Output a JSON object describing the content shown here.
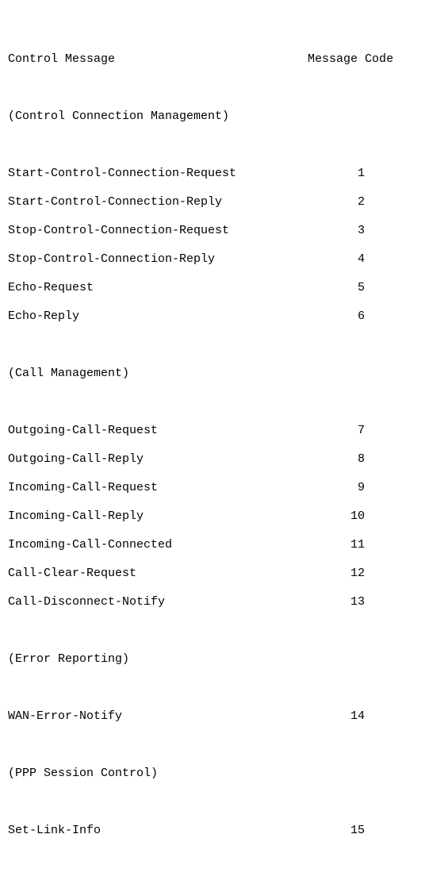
{
  "header": {
    "control_message": "Control Message",
    "message_code": "Message Code"
  },
  "groups": {
    "g1": {
      "title": "(Control Connection Management)",
      "rows": [
        {
          "name": "Start-Control-Connection-Request",
          "code": "1"
        },
        {
          "name": "Start-Control-Connection-Reply",
          "code": "2"
        },
        {
          "name": "Stop-Control-Connection-Request",
          "code": "3"
        },
        {
          "name": "Stop-Control-Connection-Reply",
          "code": "4"
        },
        {
          "name": "Echo-Request",
          "code": "5"
        },
        {
          "name": "Echo-Reply",
          "code": "6"
        }
      ]
    },
    "g2": {
      "title": "(Call Management)",
      "rows": [
        {
          "name": "Outgoing-Call-Request",
          "code": "7"
        },
        {
          "name": "Outgoing-Call-Reply",
          "code": "8"
        },
        {
          "name": "Incoming-Call-Request",
          "code": "9"
        },
        {
          "name": "Incoming-Call-Reply",
          "code": "10"
        },
        {
          "name": "Incoming-Call-Connected",
          "code": "11"
        },
        {
          "name": "Call-Clear-Request",
          "code": "12"
        },
        {
          "name": "Call-Disconnect-Notify",
          "code": "13"
        }
      ]
    },
    "g3": {
      "title": "(Error Reporting)",
      "rows": [
        {
          "name": "WAN-Error-Notify",
          "code": "14"
        }
      ]
    },
    "g4": {
      "title": "(PPP Session Control)",
      "rows": [
        {
          "name": "Set-Link-Info",
          "code": "15"
        }
      ]
    }
  }
}
